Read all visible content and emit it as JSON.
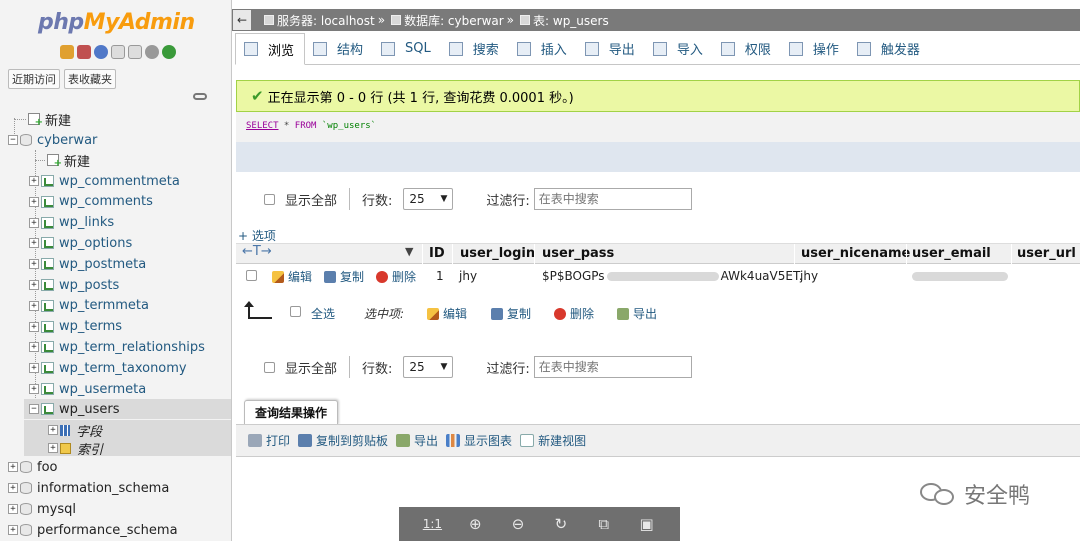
{
  "nav": {
    "logo_part1": "php",
    "logo_part2": "MyAdmin",
    "tabs": [
      "近期访问",
      "表收藏夹"
    ],
    "tree": {
      "new_label": "新建",
      "db_cyberwar": "cyberwar",
      "db_new": "新建",
      "tables": [
        "wp_commentmeta",
        "wp_comments",
        "wp_links",
        "wp_options",
        "wp_postmeta",
        "wp_posts",
        "wp_termmeta",
        "wp_terms",
        "wp_term_relationships",
        "wp_term_taxonomy",
        "wp_usermeta"
      ],
      "selected_table": "wp_users",
      "sub_fields": "字段",
      "sub_indexes": "索引",
      "other_dbs": [
        "foo",
        "information_schema",
        "mysql",
        "performance_schema"
      ]
    }
  },
  "topbar": {
    "collapse": "←",
    "server": "服务器: localhost",
    "database": "数据库: cyberwar",
    "table": "表: wp_users",
    "sep": "»"
  },
  "tabs": [
    "浏览",
    "结构",
    "SQL",
    "搜索",
    "插入",
    "导出",
    "导入",
    "权限",
    "操作",
    "触发器"
  ],
  "main": {
    "success_message": "正在显示第 0 - 0 行 (共 1 行, 查询花费 0.0001 秒。)",
    "sql": {
      "select": "SELECT",
      "star": " * ",
      "from": "FROM",
      "table": "`wp_users`"
    },
    "nav": {
      "show_all": "显示全部",
      "rows_label": "行数:",
      "rows_value": "25",
      "filter_label": "过滤行:",
      "search_placeholder": "在表中搜索"
    },
    "options_link": "+ 选项",
    "arrows": "←T→",
    "columns": [
      "ID",
      "user_login",
      "user_pass",
      "user_nicename",
      "user_email",
      "user_url"
    ],
    "row": {
      "edit": "编辑",
      "copy": "复制",
      "delete": "删除",
      "id": "1",
      "user_login": "jhy",
      "user_pass_start": "$P$BOGPs",
      "user_pass_end": "AWk4uaV5ET.",
      "user_nicename": "jhy"
    },
    "bulk": {
      "select_all": "全选",
      "with_selected": "选中项:",
      "edit": "编辑",
      "copy": "复制",
      "delete": "删除",
      "export": "导出"
    },
    "query_results": {
      "legend": "查询结果操作",
      "print": "打印",
      "copy_clipboard": "复制到剪贴板",
      "export": "导出",
      "chart": "显示图表",
      "create_view": "新建视图"
    }
  },
  "viewer": {
    "ratio": "1:1"
  },
  "watermark": "安全鸭"
}
